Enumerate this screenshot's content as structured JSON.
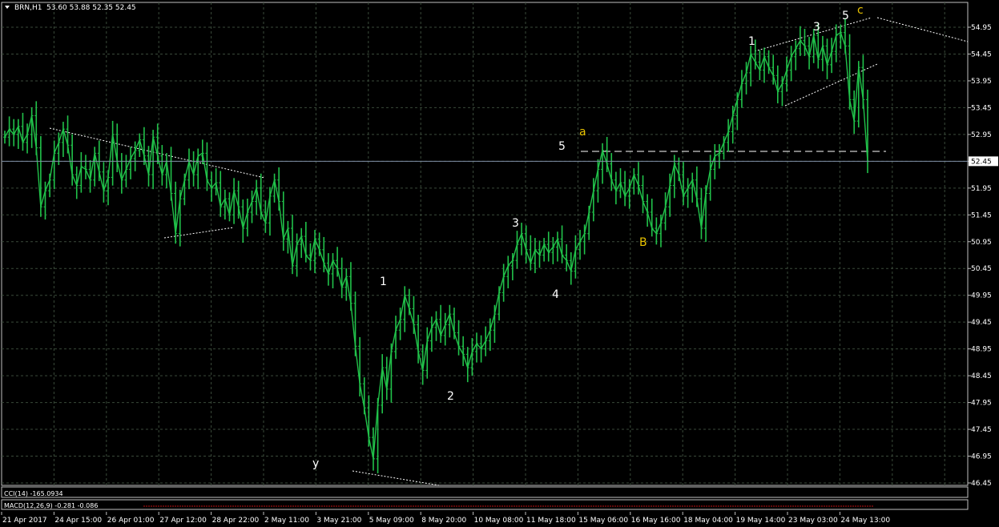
{
  "header": {
    "symbol_timeframe": "BRN,H1",
    "ohlc": "53.60 53.88 52.35 52.45"
  },
  "colors": {
    "background": "#000000",
    "grid": "#3a4a3a",
    "candles": "#21c24a",
    "axis": "#c0c0c0",
    "price_line": "#7f8fa6",
    "label_white": "#ffffff",
    "label_yellow": "#e9c300",
    "trendline": "#ffffff"
  },
  "chart_data": {
    "type": "line",
    "title": "",
    "xlabel": "",
    "ylabel": "",
    "ylim": [
      46.45,
      55.2
    ],
    "y_ticks": [
      54.95,
      54.45,
      53.95,
      53.45,
      52.95,
      52.45,
      51.95,
      51.45,
      50.95,
      50.45,
      49.95,
      49.45,
      48.95,
      48.45,
      47.95,
      47.45,
      46.95,
      46.45
    ],
    "current_price": "52.45",
    "x_ticks": [
      "21 Apr 2017",
      "24 Apr 15:00",
      "26 Apr 01:00",
      "27 Apr 12:00",
      "28 Apr 22:00",
      "2 May 11:00",
      "3 May 21:00",
      "5 May 09:00",
      "8 May 20:00",
      "10 May 08:00",
      "11 May 18:00",
      "15 May 06:00",
      "16 May 16:00",
      "18 May 04:00",
      "19 May 14:00",
      "23 May 03:00",
      "24 May 13:00"
    ],
    "series": [
      {
        "values": [
          52.9,
          53.05,
          52.95,
          53.1,
          52.8,
          52.95,
          53.3,
          52.7,
          51.6,
          51.9,
          52.1,
          52.6,
          52.8,
          53.05,
          52.75,
          52.2,
          52.0,
          52.35,
          52.3,
          52.1,
          52.6,
          52.25,
          51.9,
          52.15,
          52.95,
          52.45,
          52.1,
          52.3,
          52.5,
          52.65,
          52.85,
          52.55,
          52.2,
          52.9,
          52.55,
          52.2,
          52.45,
          51.85,
          51.1,
          51.75,
          52.1,
          52.45,
          52.2,
          52.55,
          52.6,
          52.1,
          51.95,
          52.05,
          51.6,
          51.75,
          51.45,
          51.9,
          51.6,
          51.2,
          51.5,
          51.7,
          51.95,
          51.5,
          51.3,
          51.8,
          52.1,
          51.7,
          51.0,
          51.2,
          50.5,
          50.9,
          51.05,
          50.7,
          50.6,
          51.0,
          50.8,
          50.55,
          50.35,
          50.6,
          50.45,
          50.1,
          50.3,
          49.8,
          49.0,
          48.3,
          47.85,
          47.3,
          46.9,
          47.9,
          48.6,
          48.2,
          48.9,
          49.3,
          49.5,
          49.95,
          49.7,
          49.4,
          48.9,
          48.55,
          49.1,
          49.35,
          49.5,
          49.2,
          49.4,
          49.6,
          49.25,
          49.0,
          48.85,
          48.6,
          48.9,
          49.05,
          48.95,
          49.1,
          49.3,
          49.6,
          50.0,
          50.3,
          50.5,
          50.6,
          50.9,
          51.1,
          50.8,
          50.55,
          50.8,
          50.7,
          50.9,
          50.75,
          50.85,
          51.0,
          50.7,
          50.6,
          50.4,
          50.8,
          50.95,
          51.1,
          51.5,
          51.9,
          52.3,
          52.65,
          52.4,
          52.1,
          51.9,
          52.05,
          51.8,
          51.95,
          52.2,
          52.0,
          51.7,
          51.5,
          51.2,
          51.1,
          51.3,
          51.6,
          52.0,
          52.4,
          52.2,
          51.8,
          51.95,
          52.1,
          51.75,
          51.2,
          51.85,
          52.3,
          52.55,
          52.6,
          52.8,
          53.0,
          53.3,
          53.6,
          53.9,
          54.1,
          54.45,
          54.3,
          54.15,
          54.4,
          54.2,
          54.05,
          53.75,
          53.9,
          54.15,
          54.4,
          54.55,
          54.7,
          54.6,
          54.4,
          54.8,
          54.35,
          54.6,
          54.25,
          54.5,
          54.8,
          54.85,
          54.6,
          53.6,
          53.2,
          54.2,
          53.6,
          52.45
        ]
      }
    ],
    "annotations": [
      {
        "text": "y",
        "color": "white"
      },
      {
        "text": "1",
        "color": "white"
      },
      {
        "text": "2",
        "color": "white"
      },
      {
        "text": "3",
        "color": "white"
      },
      {
        "text": "4",
        "color": "white"
      },
      {
        "text": "5",
        "color": "white"
      },
      {
        "text": "a",
        "color": "yellow"
      },
      {
        "text": "B",
        "color": "yellow"
      },
      {
        "text": "1",
        "color": "white"
      },
      {
        "text": "3",
        "color": "white"
      },
      {
        "text": "5",
        "color": "white"
      },
      {
        "text": "c",
        "color": "yellow"
      }
    ],
    "grid": true
  },
  "indicators": [
    {
      "label": "CCI(14) -165.0934"
    },
    {
      "label": "MACD(12,26,9) -0.281 -0.086"
    }
  ]
}
